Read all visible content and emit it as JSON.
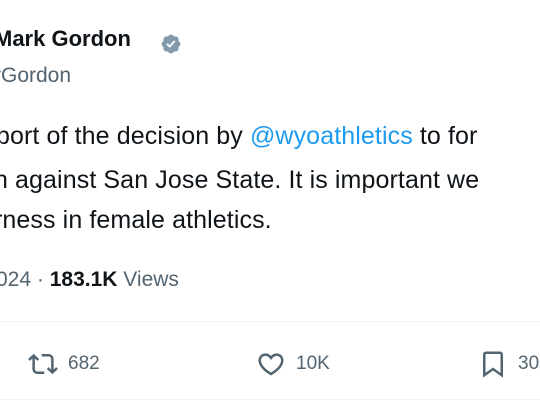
{
  "author": {
    "name": "Mark Gordon",
    "handle": "rGordon",
    "verified_color": "#829aab"
  },
  "tweet": {
    "line1_start": "port of the decision by ",
    "mention": "@wyoathletics",
    "line1_end": " to for",
    "line2": "h against San Jose State. It is important we",
    "line3": "rness in female athletics."
  },
  "meta": {
    "date_fragment": "024",
    "separator": "·",
    "views_count": "183.1K",
    "views_label": "Views"
  },
  "actions": {
    "retweets": "682",
    "likes": "10K",
    "bookmarks": "30"
  },
  "colors": {
    "text": "#0f1419",
    "secondary": "#536471",
    "link": "#1d9bf0"
  }
}
